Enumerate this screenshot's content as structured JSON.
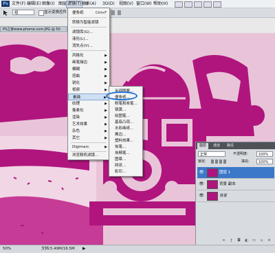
{
  "app": {
    "logo": "Ps"
  },
  "menubar": {
    "items": [
      {
        "label": "文件(F)"
      },
      {
        "label": "编辑(E)"
      },
      {
        "label": "图像(I)"
      },
      {
        "label": "图层(L)"
      },
      {
        "label": "选择(S)"
      },
      {
        "label": "滤镜(T)",
        "active": true
      },
      {
        "label": "分析(A)"
      },
      {
        "label": "3D(D)"
      },
      {
        "label": "视图(V)"
      },
      {
        "label": "窗口(W)"
      },
      {
        "label": "帮助(H)"
      }
    ]
  },
  "options_bar": {
    "mode_value": "组",
    "checkbox_label": "显示变换控件"
  },
  "document": {
    "tab_title": "PS之家www.phome.com.JPG @ 50",
    "zoom": "50%",
    "doc_info": "文档:5.49M/16.5M"
  },
  "filter_menu": {
    "items": [
      {
        "label": "便条纸",
        "shortcut": "Ctrl+F"
      },
      {
        "label": "转换为智能滤镜"
      },
      {
        "label": "滤镜库(G)..."
      },
      {
        "label": "液化(L)..."
      },
      {
        "label": "消失点(V)..."
      },
      {
        "label": "风格化",
        "submenu": true
      },
      {
        "label": "画笔描边",
        "submenu": true
      },
      {
        "label": "模糊",
        "submenu": true
      },
      {
        "label": "扭曲",
        "submenu": true
      },
      {
        "label": "锐化",
        "submenu": true
      },
      {
        "label": "视频",
        "submenu": true
      },
      {
        "label": "素描",
        "submenu": true,
        "highlighted": true
      },
      {
        "label": "纹理",
        "submenu": true
      },
      {
        "label": "像素化",
        "submenu": true
      },
      {
        "label": "渲染",
        "submenu": true
      },
      {
        "label": "艺术效果",
        "submenu": true
      },
      {
        "label": "杂色",
        "submenu": true
      },
      {
        "label": "其它",
        "submenu": true
      },
      {
        "label": "Digimarc",
        "submenu": true
      },
      {
        "label": "浏览联机滤镜..."
      }
    ]
  },
  "sketch_submenu": {
    "items": [
      {
        "label": "半调图案..."
      },
      {
        "label": "便条纸..."
      },
      {
        "label": "粉笔和炭笔..."
      },
      {
        "label": "铬黄..."
      },
      {
        "label": "绘图笔..."
      },
      {
        "label": "基底凸现..."
      },
      {
        "label": "水彩画纸..."
      },
      {
        "label": "撕边..."
      },
      {
        "label": "塑料效果..."
      },
      {
        "label": "炭笔..."
      },
      {
        "label": "炭精笔..."
      },
      {
        "label": "图章..."
      },
      {
        "label": "网状..."
      },
      {
        "label": "影印..."
      }
    ],
    "circled": "便条纸..."
  },
  "layers_panel": {
    "tabs": [
      "图层",
      "通道",
      "路径"
    ],
    "blend_mode": "正常",
    "opacity_label": "不透明度:",
    "opacity_value": "100%",
    "lock_label": "锁定:",
    "fill_label": "填充:",
    "fill_value": "100%",
    "layers": [
      {
        "name": "图层 1",
        "active": true
      },
      {
        "name": "背景 副本"
      },
      {
        "name": "背景"
      }
    ]
  },
  "colors": {
    "accent": "#1a6fd6",
    "image_magenta": "#b0157e",
    "image_pink": "#e9c4d8"
  }
}
